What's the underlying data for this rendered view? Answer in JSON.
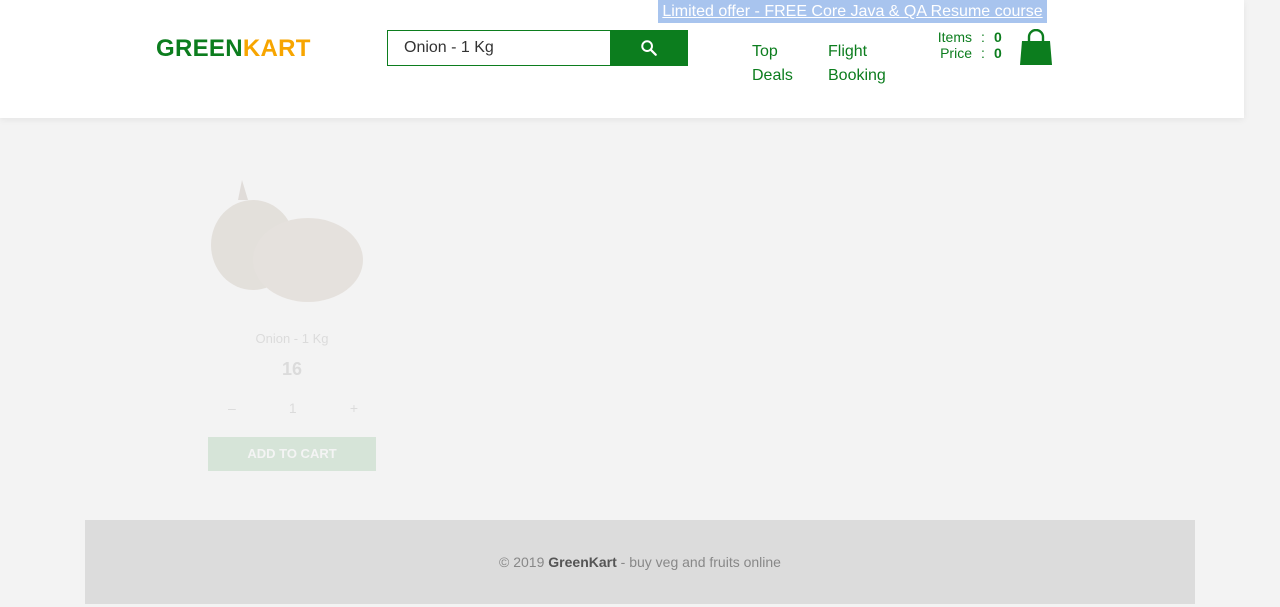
{
  "header": {
    "offer_text": "Limited offer - FREE Core Java & QA Resume course",
    "logo_green": "GREEN",
    "logo_kart": "KART",
    "search": {
      "value": "Onion - 1 Kg"
    },
    "nav": {
      "top_deals": [
        "Top",
        "Deals"
      ],
      "flight_booking": [
        "Flight",
        "Booking"
      ]
    },
    "cart": {
      "items_label": "Items",
      "items_value": "0",
      "price_label": "Price",
      "price_value": "0",
      "separator": ":"
    }
  },
  "product": {
    "name": "Onion - 1 Kg",
    "price": "16",
    "quantity": "1",
    "decrement": "–",
    "increment": "+",
    "add_label": "ADD TO CART"
  },
  "footer": {
    "year_prefix": "© 2019",
    "brand": "GreenKart",
    "tagline": "- buy veg and fruits online"
  },
  "colors": {
    "brand_green": "#0c7d1e",
    "brand_orange": "#f7a500",
    "offer_bg": "#a8c4ee"
  }
}
